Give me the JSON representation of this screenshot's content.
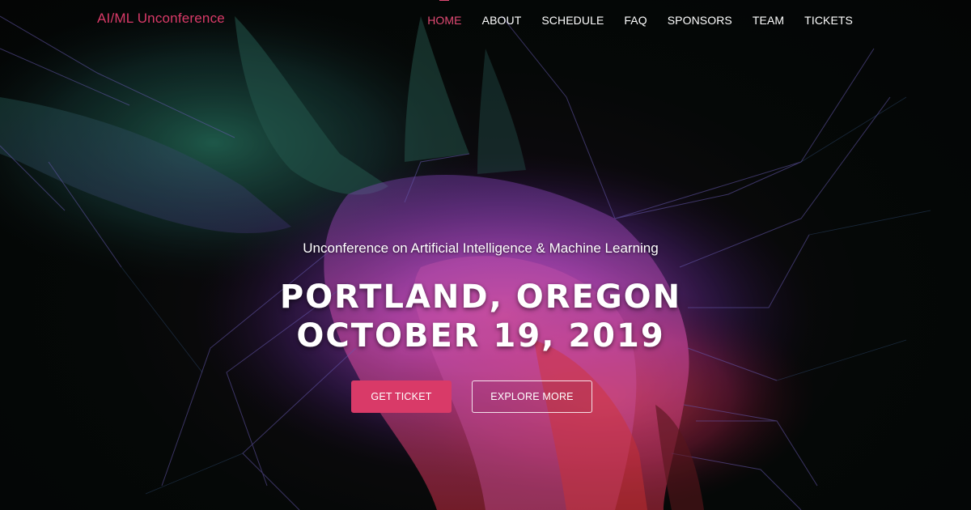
{
  "header": {
    "brand": "AI/ML Unconference",
    "nav": [
      {
        "label": "HOME",
        "active": true
      },
      {
        "label": "ABOUT",
        "active": false
      },
      {
        "label": "SCHEDULE",
        "active": false
      },
      {
        "label": "FAQ",
        "active": false
      },
      {
        "label": "SPONSORS",
        "active": false
      },
      {
        "label": "TEAM",
        "active": false
      },
      {
        "label": "TICKETS",
        "active": false
      }
    ]
  },
  "hero": {
    "subtitle": "Unconference on Artificial Intelligence & Machine Learning",
    "location": "PORTLAND, OREGON",
    "date": "OCTOBER 19, 2019",
    "background_image": "colorful-net-sculpture",
    "primary_button": "GET TICKET",
    "secondary_button": "EXPLORE MORE"
  },
  "colors": {
    "accent": "#d93a68",
    "nav_active": "#e24a74",
    "text": "#ffffff",
    "background": "#070a09"
  }
}
